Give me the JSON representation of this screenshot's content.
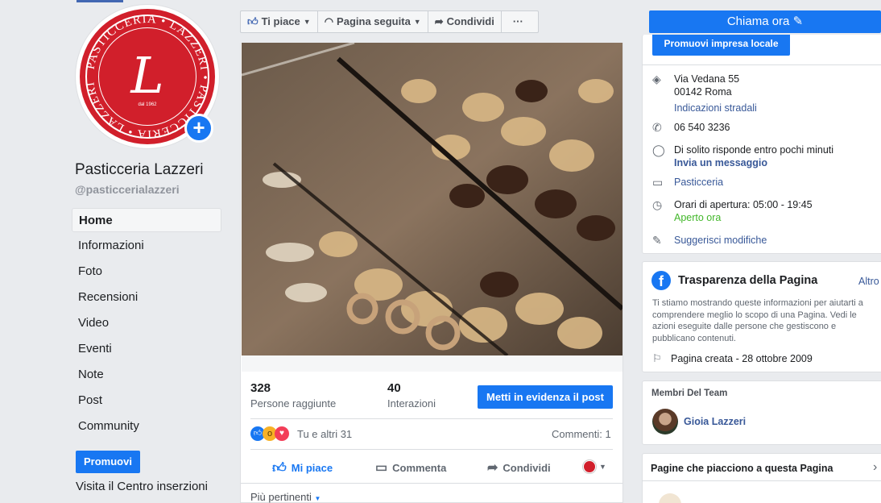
{
  "sidebar": {
    "page_name": "Pasticceria Lazzeri",
    "handle": "@pasticcerialazzeri",
    "logo": {
      "ring_text": "PASTICCERIA LAZZERI",
      "monogram": "L",
      "since": "dal 1962"
    },
    "nav": [
      {
        "label": "Home",
        "active": true
      },
      {
        "label": "Informazioni"
      },
      {
        "label": "Foto"
      },
      {
        "label": "Recensioni"
      },
      {
        "label": "Video"
      },
      {
        "label": "Eventi"
      },
      {
        "label": "Note"
      },
      {
        "label": "Post"
      },
      {
        "label": "Community"
      }
    ],
    "promote_button": "Promuovi",
    "ads_center_link": "Visita il Centro inserzioni"
  },
  "topbar": {
    "like": "Ti piace",
    "follow": "Pagina seguita",
    "share": "Condividi",
    "more": "···",
    "call_button": "Chiama ora"
  },
  "post": {
    "reach_value": "328",
    "reach_label": "Persone raggiunte",
    "interactions_value": "40",
    "interactions_label": "Interazioni",
    "boost_button": "Metti in evidenza il post",
    "reactions_text": "Tu e altri 31",
    "comments_text": "Commenti: 1",
    "actions": {
      "like": "Mi piace",
      "comment": "Commenta",
      "share": "Condividi"
    },
    "sort_label": "Più pertinenti"
  },
  "about": {
    "promote_local": "Promuovi impresa locale",
    "address_line1": "Via Vedana 55",
    "address_line2": "00142 Roma",
    "directions": "Indicazioni stradali",
    "phone": "06 540 3236",
    "response": "Di solito risponde entro pochi minuti",
    "message_link": "Invia un messaggio",
    "category": "Pasticceria",
    "hours": "Orari di apertura: 05:00 - 19:45",
    "open_now": "Aperto ora",
    "suggest_edits": "Suggerisci modifiche"
  },
  "transparency": {
    "title": "Trasparenza della Pagina",
    "more": "Altro",
    "description": "Ti stiamo mostrando queste informazioni per aiutarti a comprendere meglio lo scopo di una Pagina. Vedi le azioni eseguite dalle persone che gestiscono e pubblicano contenuti.",
    "created": "Pagina creata - 28 ottobre 2009"
  },
  "team": {
    "title": "Membri Del Team",
    "member": "Gioia Lazzeri"
  },
  "liked_pages": {
    "title": "Pagine che piacciono a questa Pagina"
  },
  "colors": {
    "brand_blue": "#1877f2",
    "logo_red": "#d11f2b",
    "open_green": "#42b72a",
    "link_blue": "#385898"
  }
}
